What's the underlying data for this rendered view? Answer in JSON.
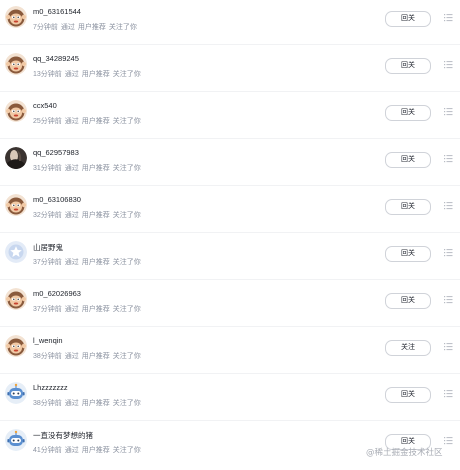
{
  "items": [
    {
      "name": "m0_63161544",
      "time": "7分钟前",
      "via": "通过",
      "source": "用户推荐",
      "action": "关注了你",
      "button": "回关",
      "avatar": "monkey"
    },
    {
      "name": "qq_34289245",
      "time": "13分钟前",
      "via": "通过",
      "source": "用户推荐",
      "action": "关注了你",
      "button": "回关",
      "avatar": "monkey"
    },
    {
      "name": "ccx540",
      "time": "25分钟前",
      "via": "通过",
      "source": "用户推荐",
      "action": "关注了你",
      "button": "回关",
      "avatar": "monkey"
    },
    {
      "name": "qq_62957983",
      "time": "31分钟前",
      "via": "通过",
      "source": "用户推荐",
      "action": "关注了你",
      "button": "回关",
      "avatar": "photo"
    },
    {
      "name": "m0_63106830",
      "time": "32分钟前",
      "via": "通过",
      "source": "用户推荐",
      "action": "关注了你",
      "button": "回关",
      "avatar": "monkey"
    },
    {
      "name": "山居野鬼",
      "time": "37分钟前",
      "via": "通过",
      "source": "用户推荐",
      "action": "关注了你",
      "button": "回关",
      "avatar": "star"
    },
    {
      "name": "m0_62026963",
      "time": "37分钟前",
      "via": "通过",
      "source": "用户推荐",
      "action": "关注了你",
      "button": "回关",
      "avatar": "monkey"
    },
    {
      "name": "l_wenqin",
      "time": "38分钟前",
      "via": "通过",
      "source": "用户推荐",
      "action": "关注了你",
      "button": "关注",
      "avatar": "monkey"
    },
    {
      "name": "Lhzzzzzzz",
      "time": "38分钟前",
      "via": "通过",
      "source": "用户推荐",
      "action": "关注了你",
      "button": "回关",
      "avatar": "robot"
    },
    {
      "name": "一直没有梦想的猪",
      "time": "41分钟前",
      "via": "通过",
      "source": "用户推荐",
      "action": "关注了你",
      "button": "回关",
      "avatar": "robot"
    }
  ],
  "watermark": "@稀土掘金技术社区",
  "icons": {
    "more": "more-list-icon"
  },
  "colors": {
    "name": "#1d2129",
    "meta": "#8a919f",
    "button_border": "#d0d3d9",
    "divider": "#f1f2f4"
  }
}
